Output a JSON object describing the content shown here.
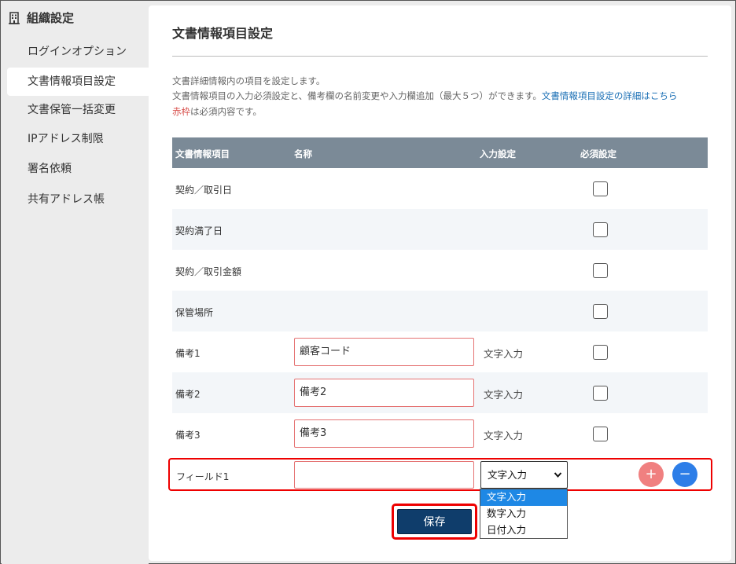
{
  "sidebar": {
    "header": "組織設定",
    "header_icon": "building-icon",
    "items": [
      {
        "label": "ログインオプション"
      },
      {
        "label": "文書情報項目設定"
      },
      {
        "label": "文書保管一括変更"
      },
      {
        "label": "IPアドレス制限"
      },
      {
        "label": "署名依頼"
      },
      {
        "label": "共有アドレス帳"
      }
    ]
  },
  "main": {
    "title": "文書情報項目設定",
    "desc1": "文書詳細情報内の項目を設定します。",
    "desc2": "文書情報項目の入力必須設定と、備考欄の名前変更や入力欄追加（最大５つ）ができます。",
    "desc2_link": "文書情報項目設定の詳細はこちら",
    "desc3_red": "赤枠",
    "desc3_rest": "は必須内容です。"
  },
  "table": {
    "headers": {
      "item": "文書情報項目",
      "name": "名称",
      "input": "入力設定",
      "required": "必須設定"
    },
    "rows": [
      {
        "label": "契約／取引日"
      },
      {
        "label": "契約満了日"
      },
      {
        "label": "契約／取引金額"
      },
      {
        "label": "保管場所"
      },
      {
        "label": "備考1",
        "name": "顧客コード",
        "input": "文字入力"
      },
      {
        "label": "備考2",
        "name": "備考2",
        "input": "文字入力"
      },
      {
        "label": "備考3",
        "name": "備考3",
        "input": "文字入力"
      }
    ]
  },
  "field": {
    "label": "フィールド1",
    "name": "",
    "select_value": "文字入力",
    "plus": "+",
    "minus": "−",
    "options": [
      "文字入力",
      "数字入力",
      "日付入力"
    ]
  },
  "save_label": "保存",
  "colors": {
    "header_bg": "#7b8a97",
    "save_bg": "#0f3d6b",
    "highlight": "#e00000",
    "link": "#1a6fb5"
  }
}
